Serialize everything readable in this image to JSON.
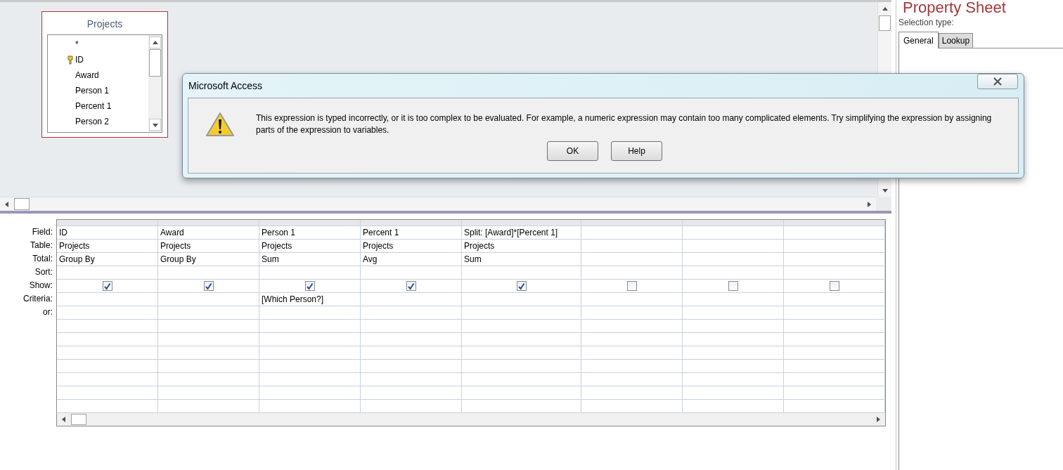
{
  "table_box": {
    "title": "Projects",
    "fields": [
      {
        "name": "*",
        "primary_key": false
      },
      {
        "name": "ID",
        "primary_key": true
      },
      {
        "name": "Award",
        "primary_key": false
      },
      {
        "name": "Person 1",
        "primary_key": false
      },
      {
        "name": "Percent 1",
        "primary_key": false
      },
      {
        "name": "Person 2",
        "primary_key": false
      }
    ]
  },
  "dialog": {
    "title": "Microsoft Access",
    "message": "This expression is typed incorrectly, or it is too complex to be evaluated. For example, a numeric expression may contain too many complicated elements. Try simplifying the expression by assigning parts of the expression to variables.",
    "buttons": [
      "OK",
      "Help"
    ]
  },
  "property_sheet": {
    "title": "Property Sheet",
    "selection_label": "Selection type:",
    "tabs": [
      {
        "label": "General",
        "selected": true
      },
      {
        "label": "Lookup",
        "selected": false
      }
    ]
  },
  "grid": {
    "row_labels": [
      "Field:",
      "Table:",
      "Total:",
      "Sort:",
      "Show:",
      "Criteria:",
      "or:"
    ],
    "columns": [
      {
        "field": "ID",
        "table": "Projects",
        "total": "Group By",
        "show": true
      },
      {
        "field": "Award",
        "table": "Projects",
        "total": "Group By",
        "show": true
      },
      {
        "field": "Person 1",
        "table": "Projects",
        "total": "Sum",
        "show": true,
        "criteria": "[Which Person?]"
      },
      {
        "field": "Percent 1",
        "table": "Projects",
        "total": "Avg",
        "show": true
      },
      {
        "field": "Split: [Award]*[Percent 1]",
        "table": "Projects",
        "total": "Sum",
        "show": true
      },
      {
        "show": false
      },
      {
        "show": false
      },
      {
        "show": false
      }
    ]
  }
}
